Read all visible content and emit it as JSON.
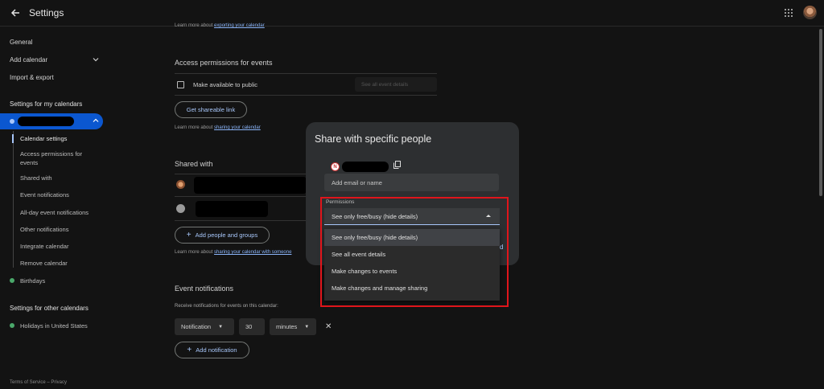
{
  "topbar": {
    "title": "Settings"
  },
  "sidebar": {
    "general": "General",
    "add_calendar": "Add calendar",
    "import_export": "Import & export",
    "my_calendars_heading": "Settings for my calendars",
    "sub_items": {
      "calendar_settings": "Calendar settings",
      "access_permissions": "Access permissions for events",
      "shared_with": "Shared with",
      "event_notifications": "Event notifications",
      "all_day_notifications": "All-day event notifications",
      "other_notifications": "Other notifications",
      "integrate": "Integrate calendar",
      "remove": "Remove calendar"
    },
    "birthdays": "Birthdays",
    "other_calendars_heading": "Settings for other calendars",
    "holidays": "Holidays in United States",
    "footer": "Terms of Service – Privacy"
  },
  "main": {
    "top_snippet_text": "Learn more about ",
    "top_snippet_link": "exporting your calendar",
    "access_title": "Access permissions for events",
    "public_label": "Make available to public",
    "public_select": "See all event details",
    "shareable_button": "Get shareable link",
    "learn_share_text": "Learn more about ",
    "learn_share_link": "sharing your calendar",
    "shared_with_title": "Shared with",
    "add_people_button": "Add people and groups",
    "learn_someone_text": "Learn more about ",
    "learn_someone_link": "sharing your calendar with someone",
    "event_notif_title": "Event notifications",
    "event_notif_desc": "Receive notifications for events on this calendar:",
    "notif_type": "Notification",
    "notif_value": "30",
    "notif_unit": "minutes",
    "add_notification_button": "Add notification"
  },
  "dialog": {
    "title": "Share with specific people",
    "owner_initial": "N",
    "email_placeholder": "Add email or name",
    "permissions_label": "Permissions",
    "selected": "See only free/busy (hide details)",
    "options": [
      "See only free/busy (hide details)",
      "See all event details",
      "Make changes to events",
      "Make changes and manage sharing"
    ],
    "partial_text": "d"
  },
  "colors": {
    "accent": "#0b57d0",
    "link": "#8ab4f8",
    "highlight_box": "#e0151b",
    "calendar_dot": "#4aa86a"
  }
}
